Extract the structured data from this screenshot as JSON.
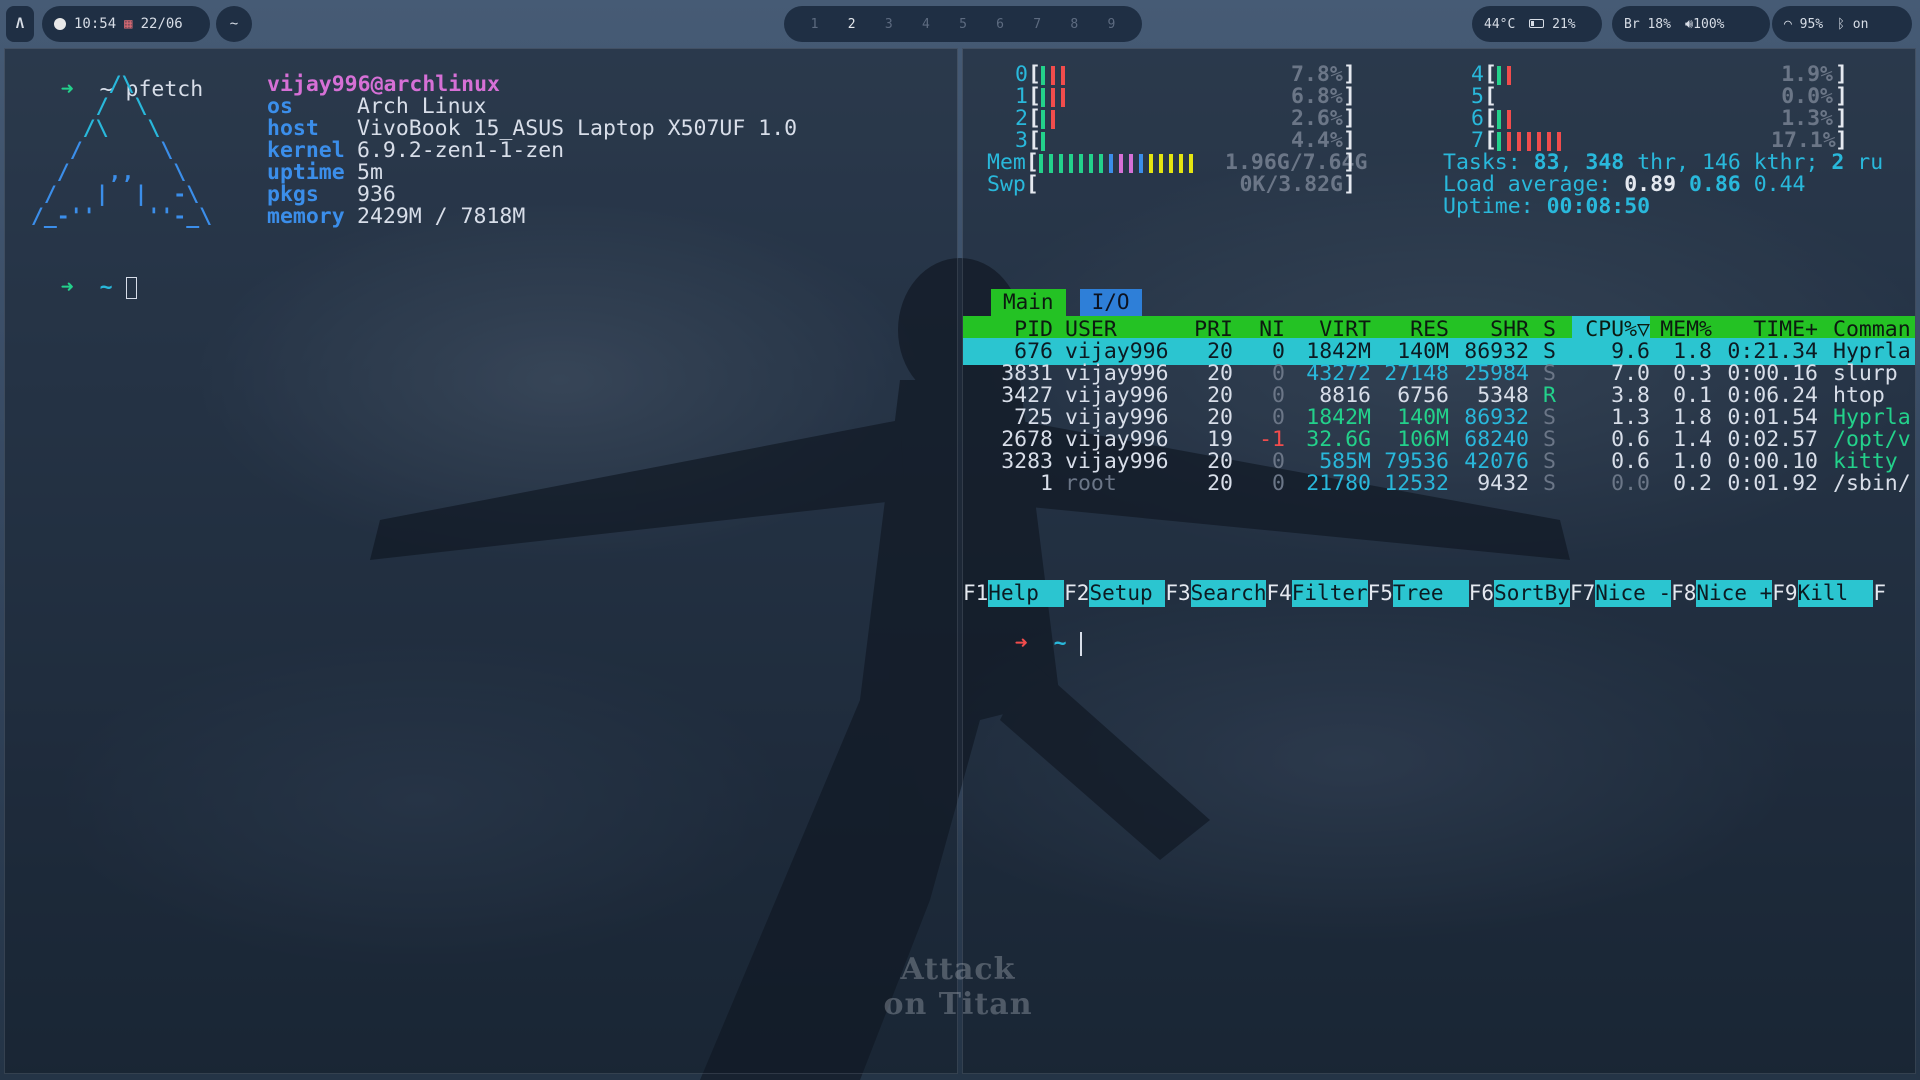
{
  "topbar": {
    "logo_glyph": "Λ",
    "time": "10:54",
    "date": "22/06",
    "launcher_label": "~",
    "workspaces": [
      "1",
      "2",
      "3",
      "4",
      "5",
      "6",
      "7",
      "8",
      "9"
    ],
    "active_workspace": "2",
    "temperature": "44°C",
    "battery": "21%",
    "brightness": "Br 18%",
    "volume": "100%",
    "wifi": "95%",
    "bluetooth": "on"
  },
  "left_terminal": {
    "prompt1": "~ pfetch",
    "ascii_art": [
      "        /\\",
      "       /  \\",
      "      /\\   \\",
      "     /      \\",
      "    /   ,,   \\",
      "   /   |  |  -\\",
      "  /_-''    ''-_\\"
    ],
    "user_host": "vijay996@archlinux",
    "fields": [
      {
        "key": "os",
        "value": "Arch Linux"
      },
      {
        "key": "host",
        "value": "VivoBook 15_ASUS Laptop X507UF 1.0"
      },
      {
        "key": "kernel",
        "value": "6.9.2-zen1-1-zen"
      },
      {
        "key": "uptime",
        "value": "5m"
      },
      {
        "key": "pkgs",
        "value": "936"
      },
      {
        "key": "memory",
        "value": "2429M / 7818M"
      }
    ],
    "prompt2": "~"
  },
  "htop": {
    "cpus_left": [
      {
        "id": "0",
        "pct": "7.8%"
      },
      {
        "id": "1",
        "pct": "6.8%"
      },
      {
        "id": "2",
        "pct": "2.6%"
      },
      {
        "id": "3",
        "pct": "4.4%"
      }
    ],
    "cpus_right": [
      {
        "id": "4",
        "pct": "1.9%"
      },
      {
        "id": "5",
        "pct": "0.0%"
      },
      {
        "id": "6",
        "pct": "1.3%"
      },
      {
        "id": "7",
        "pct": "17.1%"
      }
    ],
    "mem_label": "Mem",
    "mem_value": "1.96G/7.64G",
    "swp_label": "Swp",
    "swp_value": "0K/3.82G",
    "tasks_label": "Tasks:",
    "tasks_count": "83",
    "threads": "348",
    "thr_label": "thr,",
    "kthreads": "146 kthr;",
    "running": "2",
    "running_label": "ru",
    "load_label": "Load average:",
    "load1": "0.89",
    "load5": "0.86",
    "load15": "0.44",
    "uptime_label": "Uptime:",
    "uptime": "00:08:50",
    "tabs": [
      "Main",
      "I/O"
    ],
    "headers": [
      "PID",
      "USER",
      "PRI",
      "NI",
      "VIRT",
      "RES",
      "SHR",
      "S",
      "CPU%▽",
      "MEM%",
      "TIME+",
      "Comman"
    ],
    "rows": [
      {
        "pid": "676",
        "user": "vijay996",
        "pri": "20",
        "ni": "0",
        "virt": "1842M",
        "res": "140M",
        "shr": "86932",
        "s": "S",
        "cpu": "9.6",
        "mem": "1.8",
        "time": "0:21.34",
        "cmd": "Hyprla"
      },
      {
        "pid": "3831",
        "user": "vijay996",
        "pri": "20",
        "ni": "0",
        "virt": "43272",
        "res": "27148",
        "shr": "25984",
        "s": "S",
        "cpu": "7.0",
        "mem": "0.3",
        "time": "0:00.16",
        "cmd": "slurp"
      },
      {
        "pid": "3427",
        "user": "vijay996",
        "pri": "20",
        "ni": "0",
        "virt": "8816",
        "res": "6756",
        "shr": "5348",
        "s": "R",
        "cpu": "3.8",
        "mem": "0.1",
        "time": "0:06.24",
        "cmd": "htop"
      },
      {
        "pid": "725",
        "user": "vijay996",
        "pri": "20",
        "ni": "0",
        "virt": "1842M",
        "res": "140M",
        "shr": "86932",
        "s": "S",
        "cpu": "1.3",
        "mem": "1.8",
        "time": "0:01.54",
        "cmd": "Hyprla"
      },
      {
        "pid": "2678",
        "user": "vijay996",
        "pri": "19",
        "ni": "-1",
        "virt": "32.6G",
        "res": "106M",
        "shr": "68240",
        "s": "S",
        "cpu": "0.6",
        "mem": "1.4",
        "time": "0:02.57",
        "cmd": "/opt/v"
      },
      {
        "pid": "3283",
        "user": "vijay996",
        "pri": "20",
        "ni": "0",
        "virt": "585M",
        "res": "79536",
        "shr": "42076",
        "s": "S",
        "cpu": "0.6",
        "mem": "1.0",
        "time": "0:00.10",
        "cmd": "kitty"
      },
      {
        "pid": "1",
        "user": "root",
        "pri": "20",
        "ni": "0",
        "virt": "21780",
        "res": "12532",
        "shr": "9432",
        "s": "S",
        "cpu": "0.0",
        "mem": "0.2",
        "time": "0:01.92",
        "cmd": "/sbin/"
      }
    ],
    "fkeys": [
      {
        "key": "F1",
        "label": "Help  "
      },
      {
        "key": "F2",
        "label": "Setup "
      },
      {
        "key": "F3",
        "label": "Search"
      },
      {
        "key": "F4",
        "label": "Filter"
      },
      {
        "key": "F5",
        "label": "Tree  "
      },
      {
        "key": "F6",
        "label": "SortBy"
      },
      {
        "key": "F7",
        "label": "Nice -"
      },
      {
        "key": "F8",
        "label": "Nice +"
      },
      {
        "key": "F9",
        "label": "Kill  "
      },
      {
        "key": "F",
        "label": ""
      }
    ],
    "prompt": "~"
  },
  "wallpaper_mark": "Attack on Titan",
  "colors": {
    "accent": "#23d18b",
    "cyan": "#2bc5d0",
    "blue": "#3b8eea",
    "magenta": "#d670d6",
    "red": "#f14c4c"
  }
}
